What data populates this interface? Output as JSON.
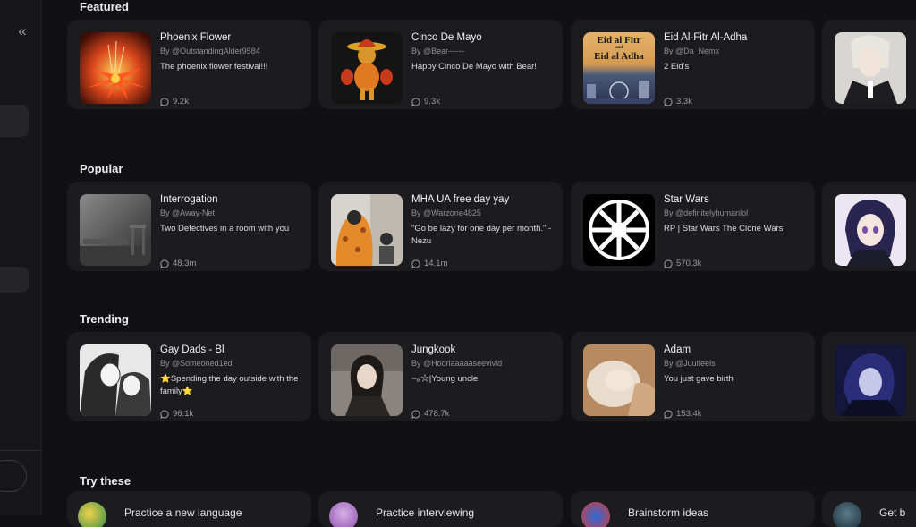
{
  "sidebar": {
    "collapse_label": "«"
  },
  "sections": [
    {
      "title": "Featured",
      "cards": [
        {
          "title": "Phoenix Flower",
          "author": "By @OutstandingAlder9584",
          "description": "The phoenix flower festival!!!",
          "count": "9.2k"
        },
        {
          "title": "Cinco De Mayo",
          "author": "By @Bear------",
          "description": "Happy Cinco De Mayo with Bear!",
          "count": "9.3k"
        },
        {
          "title": "Eid Al-Fitr Al-Adha",
          "author": "By @Da_Nemx",
          "description": "2 Eid's",
          "count": "3.3k",
          "thumb_text": [
            "Eid al Fitr",
            "and",
            "Eid al Adha"
          ]
        }
      ]
    },
    {
      "title": "Popular",
      "cards": [
        {
          "title": "Interrogation",
          "author": "By @Away-Net",
          "description": "Two Detectives in a room with you",
          "count": "48.3m"
        },
        {
          "title": "MHA UA free day yay",
          "author": "By @Warzone4825",
          "description": "\"Go be lazy for one day per month.\" -Nezu",
          "count": "14.1m"
        },
        {
          "title": "Star Wars",
          "author": "By @definitelyhumanlol",
          "description": "RP | Star Wars The Clone Wars",
          "count": "570.3k"
        }
      ]
    },
    {
      "title": "Trending",
      "cards": [
        {
          "title": "Gay Dads - Bl",
          "author": "By @Someoned1ed",
          "description": "⭐Spending the day outside with the family⭐",
          "count": "96.1k"
        },
        {
          "title": "Jungkook",
          "author": "By @Hooriaaaaaseevivid",
          "description": "~｡☆|Young uncle",
          "count": "478.7k"
        },
        {
          "title": "Adam",
          "author": "By @Juulfeels",
          "description": "You just gave birth",
          "count": "153.4k"
        }
      ]
    },
    {
      "title": "Try these",
      "cards": [
        {
          "title": "Practice a new language"
        },
        {
          "title": "Practice interviewing"
        },
        {
          "title": "Brainstorm ideas"
        },
        {
          "title": "Get b"
        }
      ]
    }
  ]
}
